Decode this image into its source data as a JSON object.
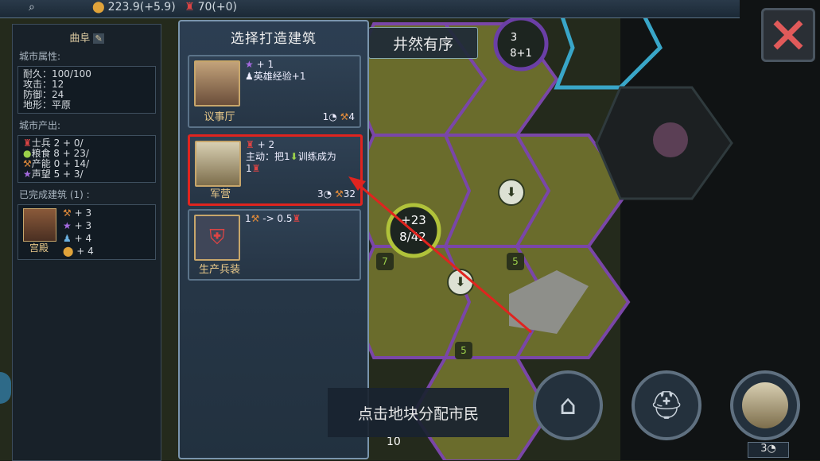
{
  "topbar": {
    "gold": "223.9(+5.9)",
    "soldiers": "70(+0)"
  },
  "map": {
    "pop_gain": "+23",
    "pop_progress": "8/42",
    "turns_badge": "3",
    "turns_badge_value": "8+1",
    "tile_vals": [
      "7",
      "5",
      "5"
    ],
    "tile_bottom": "10"
  },
  "city": {
    "name": "曲阜",
    "attr_header": "城市属性:",
    "attrs": [
      "耐久：100/100",
      "攻击：12",
      "防御：24",
      "地形：平原"
    ],
    "output_header": "城市产出:",
    "outputs": [
      "士兵 2 + 0/",
      "粮食 8 + 23/",
      "产能 0 + 14/",
      "声望 5 + 3/"
    ],
    "built_header": "已完成建筑 (1) :",
    "built": {
      "name": "宫殿",
      "stats": [
        "+ 3",
        "+ 3",
        "+ 4",
        "+ 4"
      ]
    }
  },
  "dialog": {
    "title": "选择打造建筑",
    "cards": [
      {
        "name": "议事厅",
        "lines": [
          "+ 1",
          "英雄经验+1"
        ],
        "turns": "1",
        "prod": "4",
        "selected": false
      },
      {
        "name": "军营",
        "lines": [
          "+ 2",
          "主动：把1",
          "训练成为",
          "1"
        ],
        "turns": "3",
        "prod": "32",
        "selected": true
      },
      {
        "name": "生产兵装",
        "lines": [
          "1",
          "-> 0.5"
        ],
        "turns": "",
        "prod": "",
        "selected": false
      }
    ]
  },
  "banner": {
    "text": "井然有序"
  },
  "hint": {
    "text": "点击地块分配市民"
  },
  "actions": {
    "last_turns": "3"
  },
  "colors": {
    "highlight": "#e0241f",
    "gold": "#e0a33a",
    "border": "#7a95ad"
  },
  "icons": [
    "search-icon",
    "coin-icon",
    "soldier-icon",
    "close-icon",
    "edit-icon",
    "star-icon",
    "hero-icon",
    "clock-icon",
    "hammer-icon",
    "food-icon",
    "prestige-icon",
    "fort-icon",
    "helmet-icon",
    "armor-icon"
  ]
}
